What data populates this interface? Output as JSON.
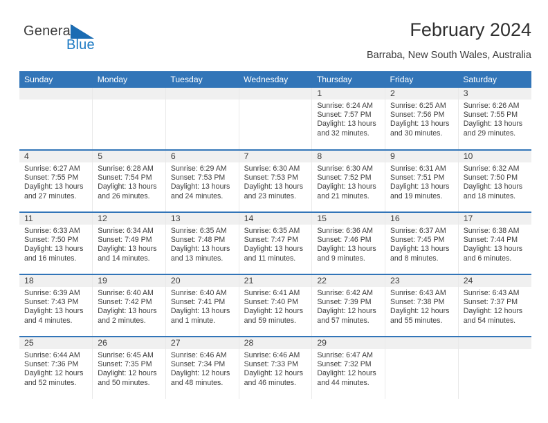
{
  "brand": {
    "word1": "General",
    "word2": "Blue",
    "triangle_color": "#1b6cb3",
    "text_color": "#1b79c3"
  },
  "header": {
    "title": "February 2024",
    "location": "Barraba, New South Wales, Australia"
  },
  "theme": {
    "header_blue": "#3275b8",
    "daynum_band": "#f0f0f0",
    "row_divider": "#3275b8"
  },
  "calendar": {
    "weekday_headers": [
      "Sunday",
      "Monday",
      "Tuesday",
      "Wednesday",
      "Thursday",
      "Friday",
      "Saturday"
    ],
    "labels": {
      "sunrise": "Sunrise:",
      "sunset": "Sunset:",
      "daylight": "Daylight:"
    },
    "weeks": [
      [
        {
          "day": "",
          "empty": true
        },
        {
          "day": "",
          "empty": true
        },
        {
          "day": "",
          "empty": true
        },
        {
          "day": "",
          "empty": true
        },
        {
          "day": "1",
          "sunrise": "Sunrise: 6:24 AM",
          "sunset": "Sunset: 7:57 PM",
          "daylight1": "Daylight: 13 hours",
          "daylight2": "and 32 minutes."
        },
        {
          "day": "2",
          "sunrise": "Sunrise: 6:25 AM",
          "sunset": "Sunset: 7:56 PM",
          "daylight1": "Daylight: 13 hours",
          "daylight2": "and 30 minutes."
        },
        {
          "day": "3",
          "sunrise": "Sunrise: 6:26 AM",
          "sunset": "Sunset: 7:55 PM",
          "daylight1": "Daylight: 13 hours",
          "daylight2": "and 29 minutes."
        }
      ],
      [
        {
          "day": "4",
          "sunrise": "Sunrise: 6:27 AM",
          "sunset": "Sunset: 7:55 PM",
          "daylight1": "Daylight: 13 hours",
          "daylight2": "and 27 minutes."
        },
        {
          "day": "5",
          "sunrise": "Sunrise: 6:28 AM",
          "sunset": "Sunset: 7:54 PM",
          "daylight1": "Daylight: 13 hours",
          "daylight2": "and 26 minutes."
        },
        {
          "day": "6",
          "sunrise": "Sunrise: 6:29 AM",
          "sunset": "Sunset: 7:53 PM",
          "daylight1": "Daylight: 13 hours",
          "daylight2": "and 24 minutes."
        },
        {
          "day": "7",
          "sunrise": "Sunrise: 6:30 AM",
          "sunset": "Sunset: 7:53 PM",
          "daylight1": "Daylight: 13 hours",
          "daylight2": "and 23 minutes."
        },
        {
          "day": "8",
          "sunrise": "Sunrise: 6:30 AM",
          "sunset": "Sunset: 7:52 PM",
          "daylight1": "Daylight: 13 hours",
          "daylight2": "and 21 minutes."
        },
        {
          "day": "9",
          "sunrise": "Sunrise: 6:31 AM",
          "sunset": "Sunset: 7:51 PM",
          "daylight1": "Daylight: 13 hours",
          "daylight2": "and 19 minutes."
        },
        {
          "day": "10",
          "sunrise": "Sunrise: 6:32 AM",
          "sunset": "Sunset: 7:50 PM",
          "daylight1": "Daylight: 13 hours",
          "daylight2": "and 18 minutes."
        }
      ],
      [
        {
          "day": "11",
          "sunrise": "Sunrise: 6:33 AM",
          "sunset": "Sunset: 7:50 PM",
          "daylight1": "Daylight: 13 hours",
          "daylight2": "and 16 minutes."
        },
        {
          "day": "12",
          "sunrise": "Sunrise: 6:34 AM",
          "sunset": "Sunset: 7:49 PM",
          "daylight1": "Daylight: 13 hours",
          "daylight2": "and 14 minutes."
        },
        {
          "day": "13",
          "sunrise": "Sunrise: 6:35 AM",
          "sunset": "Sunset: 7:48 PM",
          "daylight1": "Daylight: 13 hours",
          "daylight2": "and 13 minutes."
        },
        {
          "day": "14",
          "sunrise": "Sunrise: 6:35 AM",
          "sunset": "Sunset: 7:47 PM",
          "daylight1": "Daylight: 13 hours",
          "daylight2": "and 11 minutes."
        },
        {
          "day": "15",
          "sunrise": "Sunrise: 6:36 AM",
          "sunset": "Sunset: 7:46 PM",
          "daylight1": "Daylight: 13 hours",
          "daylight2": "and 9 minutes."
        },
        {
          "day": "16",
          "sunrise": "Sunrise: 6:37 AM",
          "sunset": "Sunset: 7:45 PM",
          "daylight1": "Daylight: 13 hours",
          "daylight2": "and 8 minutes."
        },
        {
          "day": "17",
          "sunrise": "Sunrise: 6:38 AM",
          "sunset": "Sunset: 7:44 PM",
          "daylight1": "Daylight: 13 hours",
          "daylight2": "and 6 minutes."
        }
      ],
      [
        {
          "day": "18",
          "sunrise": "Sunrise: 6:39 AM",
          "sunset": "Sunset: 7:43 PM",
          "daylight1": "Daylight: 13 hours",
          "daylight2": "and 4 minutes."
        },
        {
          "day": "19",
          "sunrise": "Sunrise: 6:40 AM",
          "sunset": "Sunset: 7:42 PM",
          "daylight1": "Daylight: 13 hours",
          "daylight2": "and 2 minutes."
        },
        {
          "day": "20",
          "sunrise": "Sunrise: 6:40 AM",
          "sunset": "Sunset: 7:41 PM",
          "daylight1": "Daylight: 13 hours",
          "daylight2": "and 1 minute."
        },
        {
          "day": "21",
          "sunrise": "Sunrise: 6:41 AM",
          "sunset": "Sunset: 7:40 PM",
          "daylight1": "Daylight: 12 hours",
          "daylight2": "and 59 minutes."
        },
        {
          "day": "22",
          "sunrise": "Sunrise: 6:42 AM",
          "sunset": "Sunset: 7:39 PM",
          "daylight1": "Daylight: 12 hours",
          "daylight2": "and 57 minutes."
        },
        {
          "day": "23",
          "sunrise": "Sunrise: 6:43 AM",
          "sunset": "Sunset: 7:38 PM",
          "daylight1": "Daylight: 12 hours",
          "daylight2": "and 55 minutes."
        },
        {
          "day": "24",
          "sunrise": "Sunrise: 6:43 AM",
          "sunset": "Sunset: 7:37 PM",
          "daylight1": "Daylight: 12 hours",
          "daylight2": "and 54 minutes."
        }
      ],
      [
        {
          "day": "25",
          "sunrise": "Sunrise: 6:44 AM",
          "sunset": "Sunset: 7:36 PM",
          "daylight1": "Daylight: 12 hours",
          "daylight2": "and 52 minutes."
        },
        {
          "day": "26",
          "sunrise": "Sunrise: 6:45 AM",
          "sunset": "Sunset: 7:35 PM",
          "daylight1": "Daylight: 12 hours",
          "daylight2": "and 50 minutes."
        },
        {
          "day": "27",
          "sunrise": "Sunrise: 6:46 AM",
          "sunset": "Sunset: 7:34 PM",
          "daylight1": "Daylight: 12 hours",
          "daylight2": "and 48 minutes."
        },
        {
          "day": "28",
          "sunrise": "Sunrise: 6:46 AM",
          "sunset": "Sunset: 7:33 PM",
          "daylight1": "Daylight: 12 hours",
          "daylight2": "and 46 minutes."
        },
        {
          "day": "29",
          "sunrise": "Sunrise: 6:47 AM",
          "sunset": "Sunset: 7:32 PM",
          "daylight1": "Daylight: 12 hours",
          "daylight2": "and 44 minutes."
        },
        {
          "day": "",
          "empty": true
        },
        {
          "day": "",
          "empty": true
        }
      ]
    ]
  }
}
